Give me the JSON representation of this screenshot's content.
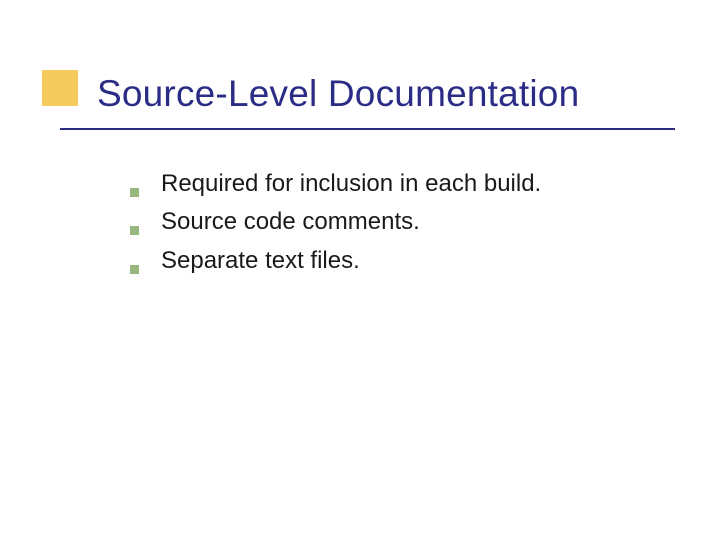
{
  "slide": {
    "title": "Source-Level Documentation",
    "bullets": [
      "Required for inclusion in each build.",
      "Source code comments.",
      "Separate text files."
    ]
  }
}
